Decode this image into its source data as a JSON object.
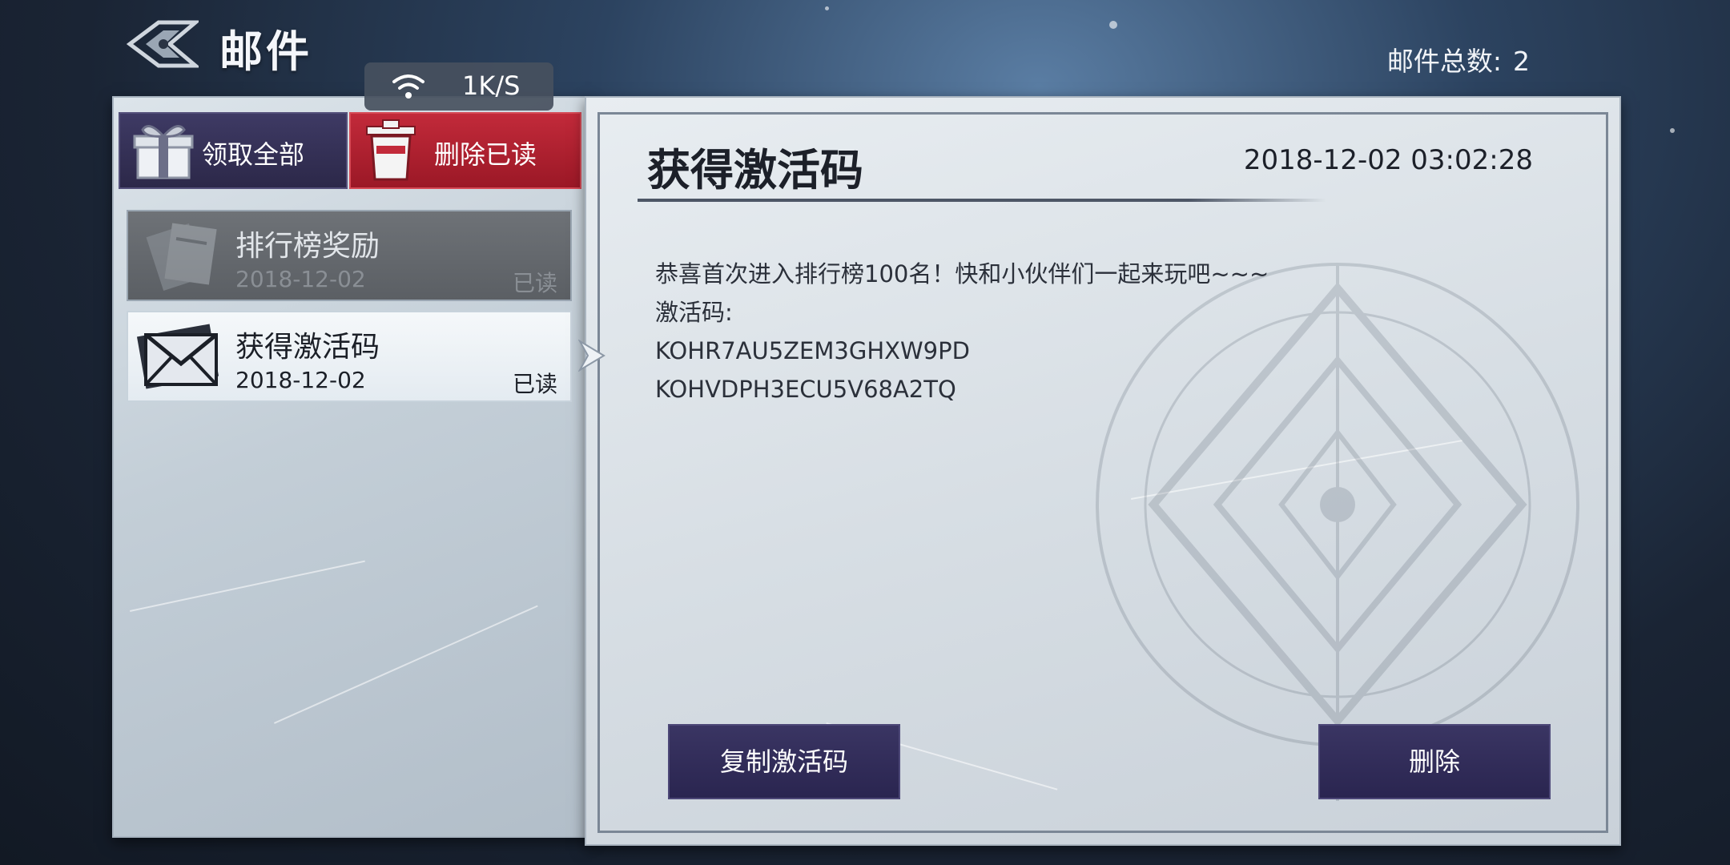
{
  "header": {
    "title": "邮件",
    "mail_total_label": "邮件总数:",
    "mail_total_value": "2"
  },
  "network": {
    "rate": "1K/S",
    "icon": "wifi-icon"
  },
  "actions": {
    "claim_all": "领取全部",
    "delete_read": "删除已读"
  },
  "mail_list": [
    {
      "title": "排行榜奖励",
      "date": "2018-12-02",
      "status": "已读",
      "icon": "document-icon"
    },
    {
      "title": "获得激活码",
      "date": "2018-12-02",
      "status": "已读",
      "icon": "envelope-icon"
    }
  ],
  "detail": {
    "title": "获得激活码",
    "time": "2018-12-02 03:02:28",
    "lines": [
      "恭喜首次进入排行榜100名！快和小伙伴们一起来玩吧~~~",
      "激活码:",
      "KOHR7AU5ZEM3GHXW9PD",
      "KOHVDPH3ECU5V68A2TQ"
    ],
    "copy_button": "复制激活码",
    "delete_button": "删除"
  },
  "colors": {
    "accent_purple": "#2c2849",
    "danger_red": "#b0202f"
  }
}
